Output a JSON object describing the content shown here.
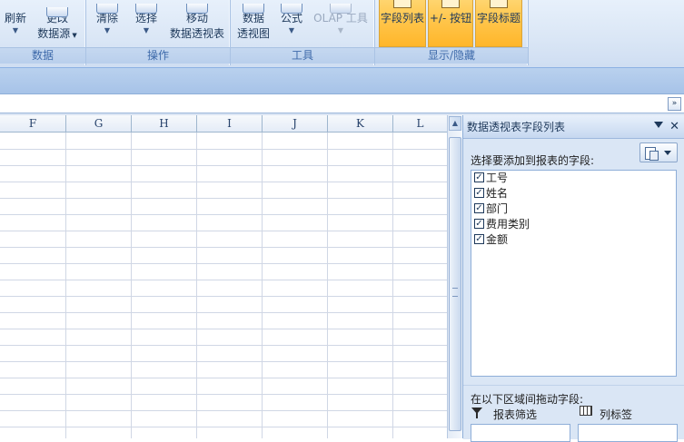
{
  "ribbon": {
    "groups": [
      {
        "label": "数据"
      },
      {
        "label": "操作"
      },
      {
        "label": "工具"
      },
      {
        "label": "显示/隐藏"
      }
    ],
    "buttons": {
      "refresh": "刷新",
      "change_source_1": "更改",
      "change_source_2": "数据源",
      "clear": "清除",
      "select": "选择",
      "move_1": "移动",
      "move_2": "数据透视表",
      "pivot_chart_1": "数据",
      "pivot_chart_2": "透视图",
      "formula": "公式",
      "olap": "OLAP 工具",
      "field_list": "字段列表",
      "plus_minus": "+/- 按钮",
      "field_headers": "字段标题"
    }
  },
  "columns": [
    "F",
    "G",
    "H",
    "I",
    "J",
    "K",
    "L"
  ],
  "pane": {
    "title": "数据透视表字段列表",
    "choose_label": "选择要添加到报表的字段:",
    "fields": [
      {
        "name": "工号",
        "checked": true
      },
      {
        "name": "姓名",
        "checked": true
      },
      {
        "name": "部门",
        "checked": true
      },
      {
        "name": "费用类别",
        "checked": true
      },
      {
        "name": "金额",
        "checked": true
      }
    ],
    "drag_label": "在以下区域间拖动字段:",
    "report_filter": "报表筛选",
    "column_labels": "列标签"
  }
}
